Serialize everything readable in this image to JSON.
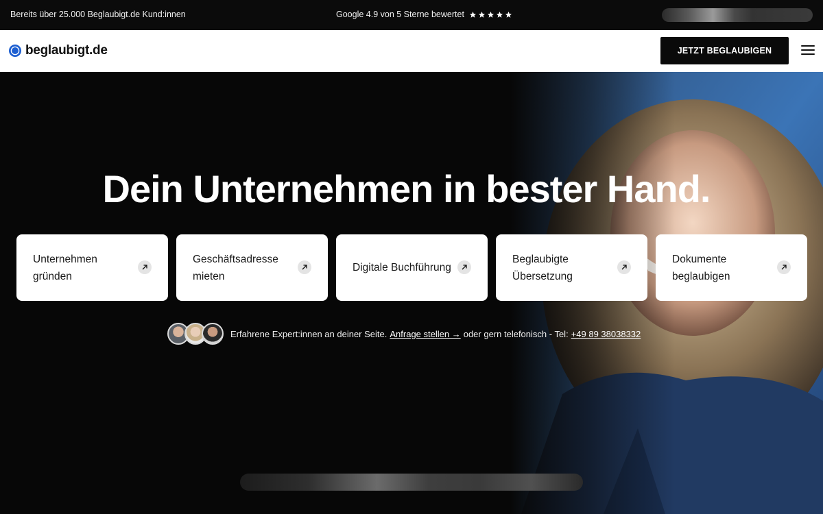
{
  "topbar": {
    "customers_text": "Bereits über 25.000 Beglaubigt.de Kund:innen",
    "rating_text": "Google 4.9 von 5 Sterne bewertet",
    "stars": 5
  },
  "header": {
    "logo_text": "beglaubigt.de",
    "cta_label": "JETZT BEGLAUBIGEN",
    "menu_icon": "hamburger-menu-icon"
  },
  "hero": {
    "headline": "Dein Unternehmen in bester Hand.",
    "cards": [
      {
        "line1": "Unternehmen",
        "line2": "gründen"
      },
      {
        "line1": "Geschäftsadresse",
        "line2": "mieten"
      },
      {
        "line1": "Digitale Buchführung",
        "line2": ""
      },
      {
        "line1": "Beglaubigte",
        "line2": "Übersetzung"
      },
      {
        "line1": "Dokumente",
        "line2": "beglaubigen"
      }
    ],
    "card_icon": "arrow-up-right-icon",
    "experts": {
      "text": "Erfahrene Expert:innen an deiner Seite.",
      "request_link": "Anfrage stellen →",
      "phone_prefix": "oder gern telefonisch - Tel:",
      "phone_link": "+49 89 38038332"
    }
  },
  "colors": {
    "accent_blue": "#1d5fd1",
    "dark": "#0a0a0a",
    "card_bg": "#ffffff"
  }
}
